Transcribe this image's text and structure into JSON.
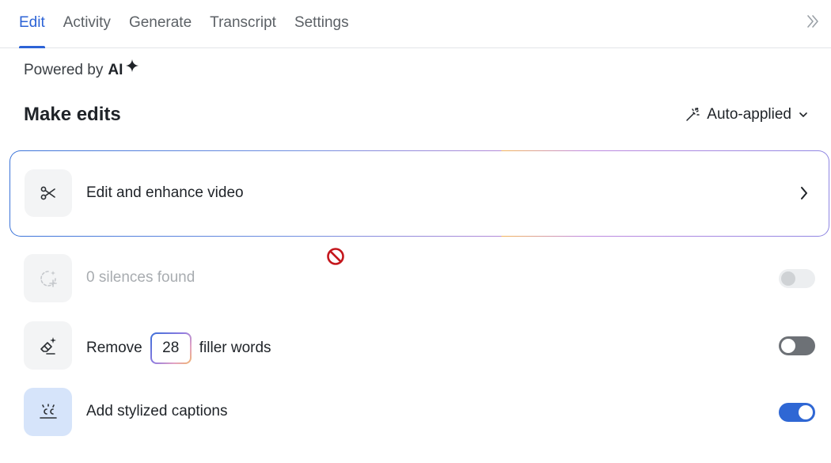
{
  "tabs": [
    {
      "label": "Edit",
      "active": true
    },
    {
      "label": "Activity",
      "active": false
    },
    {
      "label": "Generate",
      "active": false
    },
    {
      "label": "Transcript",
      "active": false
    },
    {
      "label": "Settings",
      "active": false
    }
  ],
  "powered": {
    "prefix": "Powered by",
    "ai": "AI"
  },
  "section": {
    "title": "Make edits",
    "mode_label": "Auto-applied"
  },
  "card": {
    "title": "Edit and enhance video"
  },
  "rows": {
    "silences": {
      "label": "0 silences found",
      "toggle": "disabled"
    },
    "filler": {
      "prefix": "Remove",
      "count": "28",
      "suffix": "filler words",
      "toggle": "off"
    },
    "captions": {
      "label": "Add stylized captions",
      "toggle": "on"
    }
  },
  "colors": {
    "accent": "#2c63d6",
    "toggle_on": "#2f67d4",
    "toggle_off": "#6d7176"
  },
  "icons": {
    "collapse": "double-chevron-right-icon",
    "sparkle": "sparkle-icon",
    "wand": "magic-wand-icon",
    "scissors": "scissors-icon",
    "silence": "silence-detect-icon",
    "eraser": "eraser-sparkle-icon",
    "captions": "captions-cc-icon",
    "not_allowed": "not-allowed-cursor-icon"
  }
}
